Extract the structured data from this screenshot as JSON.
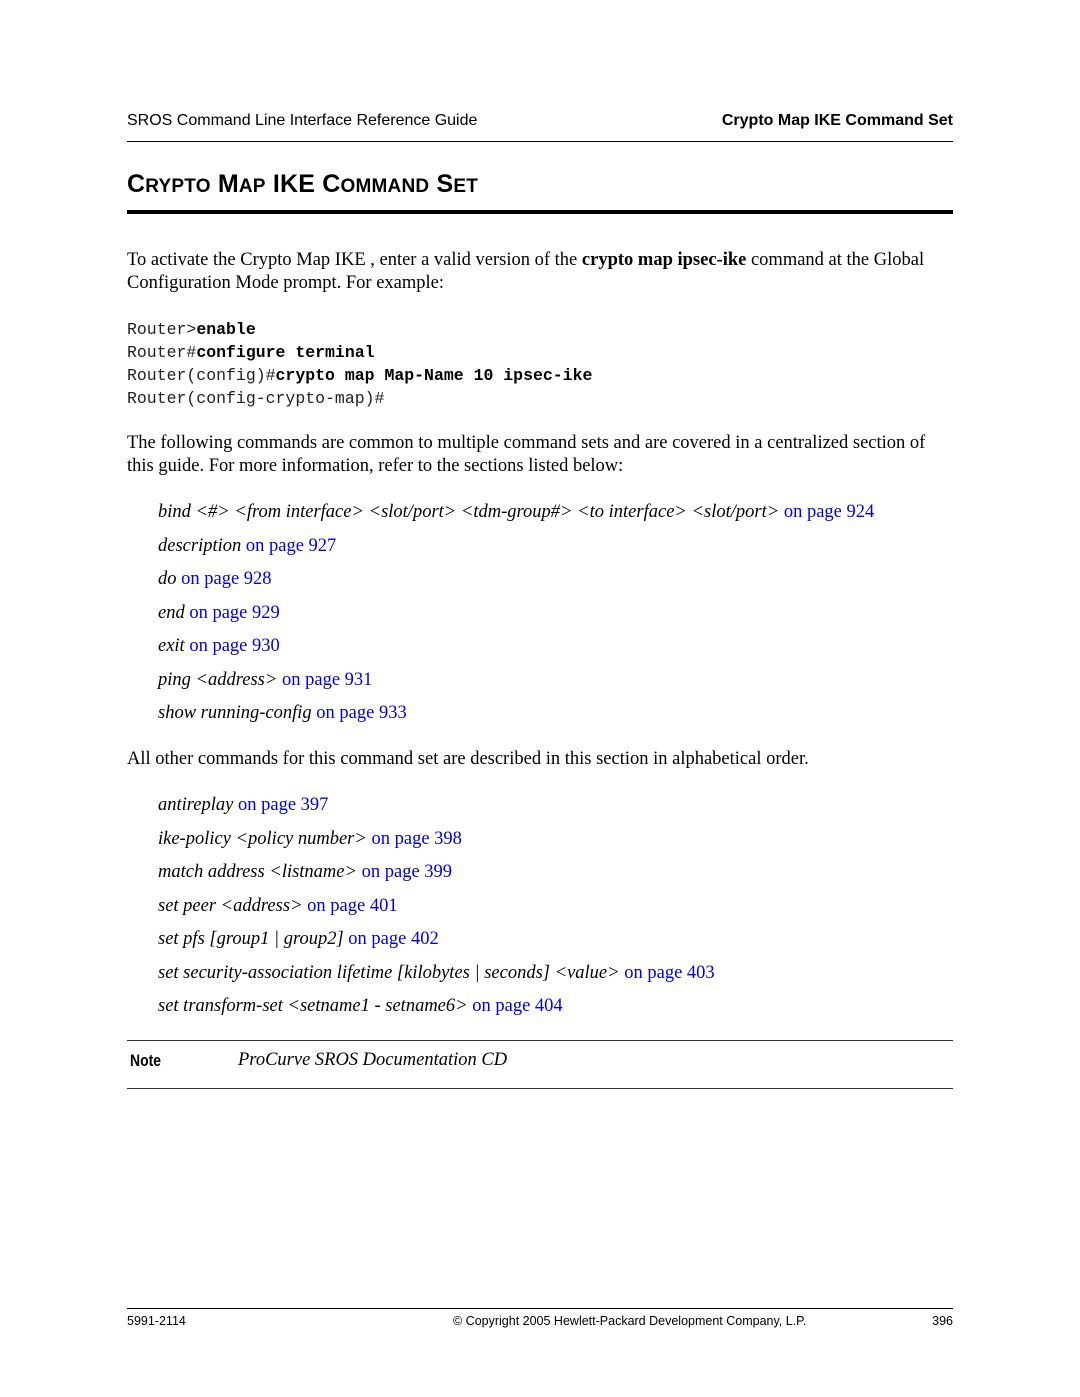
{
  "header": {
    "left": "SROS Command Line Interface Reference Guide",
    "right": "Crypto Map IKE Command Set"
  },
  "title": {
    "parts": [
      {
        "cap": "C",
        "rest": "RYPTO"
      },
      {
        "cap": "M",
        "rest": "AP"
      },
      {
        "cap": "IKE",
        "rest": ""
      },
      {
        "cap": "C",
        "rest": "OMMAND"
      },
      {
        "cap": "S",
        "rest": "ET"
      }
    ],
    "full": "Crypto Map IKE Command Set"
  },
  "intro": {
    "before": "To activate the Crypto Map IKE , enter a valid version of the ",
    "bold": "crypto map ipsec-ike",
    "after": " command at the Global Configuration Mode prompt. For example:"
  },
  "code": [
    {
      "prompt": "Router>",
      "command": "enable"
    },
    {
      "prompt": "Router#",
      "command": "configure terminal"
    },
    {
      "prompt": "Router(config)#",
      "command": "crypto map Map-Name 10 ipsec-ike"
    },
    {
      "prompt": "Router(config-crypto-map)#",
      "command": ""
    }
  ],
  "common_intro": "The following commands are common to multiple command sets and are covered in a centralized section of this guide. For more information, refer to the sections listed below:",
  "common_commands": [
    {
      "command": "bind <#> <from interface> <slot/port> <tdm-group#> <to interface> <slot/port>",
      "link": "on page 924"
    },
    {
      "command": "description",
      "link": "on page 927"
    },
    {
      "command": "do",
      "link": "on page 928"
    },
    {
      "command": "end",
      "link": "on page 929"
    },
    {
      "command": "exit",
      "link": "on page 930"
    },
    {
      "command": "ping <address>",
      "link": "on page 931"
    },
    {
      "command": "show running-config",
      "link": "on page 933"
    }
  ],
  "other_intro": "All other commands for this command set are described in this section in alphabetical order.",
  "other_commands": [
    {
      "command": "antireplay",
      "link": "on page 397"
    },
    {
      "command": "ike-policy <policy number>",
      "link": "on page 398"
    },
    {
      "command": "match address <listname>",
      "link": "on page 399"
    },
    {
      "command": "set peer <address>",
      "link": "on page 401"
    },
    {
      "command": "set pfs [group1 | group2]",
      "link": "on page 402"
    },
    {
      "command": "set security-association lifetime [kilobytes | seconds] <value>",
      "link": "on page 403"
    },
    {
      "command": "set transform-set <setname1 - setname6>",
      "link": "on page 404"
    }
  ],
  "note": {
    "label": "Note",
    "text": "ProCurve SROS Documentation CD"
  },
  "footer": {
    "doc_number": "5991-2114",
    "copyright": "© Copyright 2005 Hewlett-Packard Development Company, L.P.",
    "page_number": "396"
  },
  "colors": {
    "link": "#0000ee",
    "text": "#000000"
  }
}
